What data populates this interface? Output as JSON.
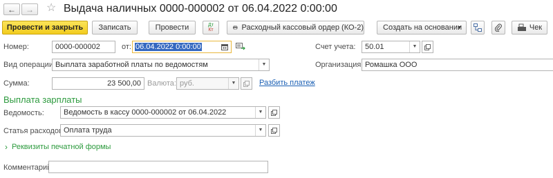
{
  "window": {
    "title": "Выдача наличных 0000-000002 от 06.04.2022 0:00:00"
  },
  "toolbar": {
    "post_close": "Провести и закрыть",
    "save": "Записать",
    "post": "Провести",
    "report": "Расходный кассовый ордер (КО-2)",
    "create_based": "Создать на основании",
    "check": "Чек",
    "dtkt_top": "Дт",
    "dtkt_bottom": "Кт"
  },
  "form": {
    "number_label": "Номер:",
    "number_value": "0000-000002",
    "date_label": "от:",
    "date_value": "06.04.2022  0:00:00",
    "account_label": "Счет учета:",
    "account_value": "50.01",
    "operation_label": "Вид операции:",
    "operation_value": "Выплата заработной платы по ведомостям",
    "org_label": "Организация:",
    "org_value": "Ромашка ООО",
    "amount_label": "Сумма:",
    "amount_value": "23 500,00",
    "currency_label": "Валюта:",
    "currency_value": "руб.",
    "split_link": "Разбить платеж"
  },
  "salary": {
    "section_title": "Выплата зарплаты",
    "statement_label": "Ведомость:",
    "statement_value": "Ведомость в кассу 0000-000002 от 06.04.2022",
    "expense_label": "Статья расходов:",
    "expense_value": "Оплата труда"
  },
  "print_section": {
    "title": "Реквизиты печатной формы"
  },
  "comment": {
    "label": "Комментарий:",
    "value": ""
  },
  "colors": {
    "primary": "#f5d130",
    "accent_green": "#2c9a3d",
    "link": "#1a5fb4",
    "selection": "#3568c0"
  }
}
